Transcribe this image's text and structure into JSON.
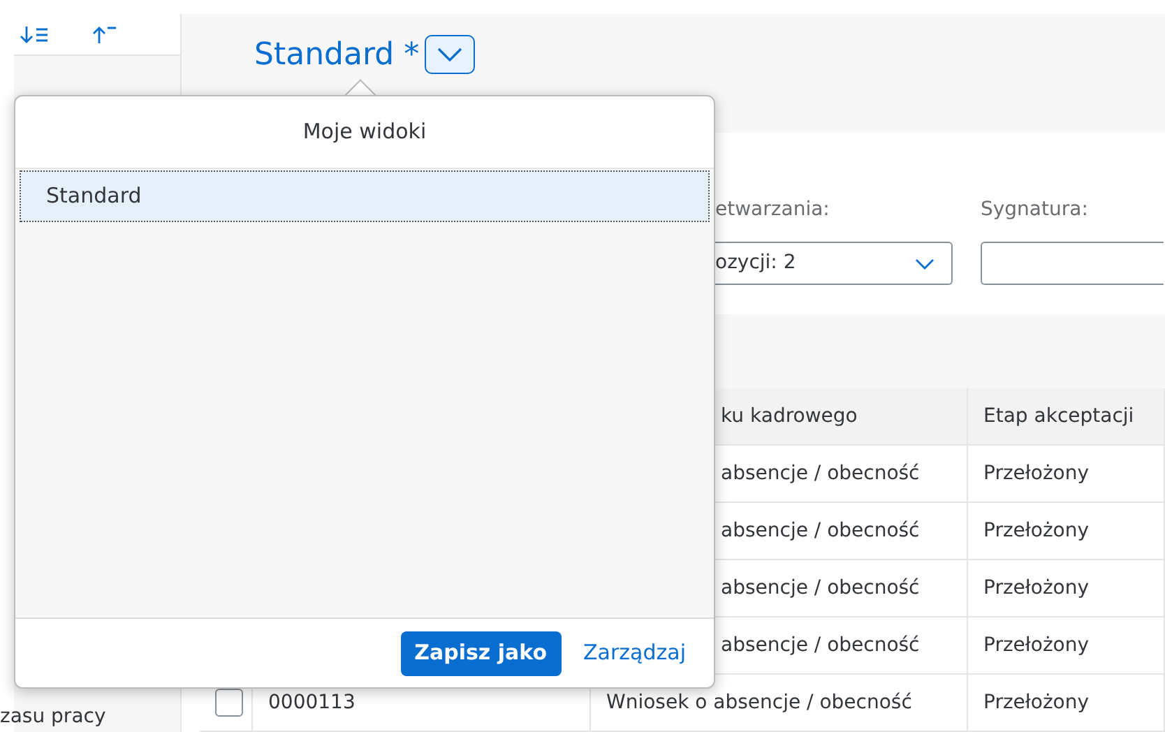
{
  "sidebar": {
    "item_text": "zasu pracy"
  },
  "header": {
    "title": "Standard *"
  },
  "filters": [
    {
      "kind": "select",
      "label": "etwarzania:",
      "value": "ozycji: 2"
    },
    {
      "kind": "input",
      "label": "Sygnatura:"
    }
  ],
  "table": {
    "columns": [
      null,
      "ku kadrowego",
      "Etap akceptacji"
    ],
    "rows": [
      {
        "cells": [
          null,
          "absencje / obecność",
          "Przełożony"
        ]
      },
      {
        "cells": [
          null,
          "absencje / obecność",
          "Przełożony"
        ]
      },
      {
        "cells": [
          null,
          "absencje / obecność",
          "Przełożony"
        ]
      },
      {
        "cells": [
          null,
          "absencje / obecność",
          "Przełożony"
        ]
      },
      {
        "checked": false,
        "cells": [
          "0000113",
          "Wniosek o absencje / obecność",
          "Przełożony"
        ]
      }
    ]
  },
  "popover": {
    "title": "Moje widoki",
    "items": [
      {
        "label": "Standard",
        "selected": true
      }
    ],
    "buttons": [
      {
        "label": "Zapisz jako",
        "kind": "primary"
      },
      {
        "label": "Zarządzaj",
        "kind": "link"
      }
    ]
  }
}
